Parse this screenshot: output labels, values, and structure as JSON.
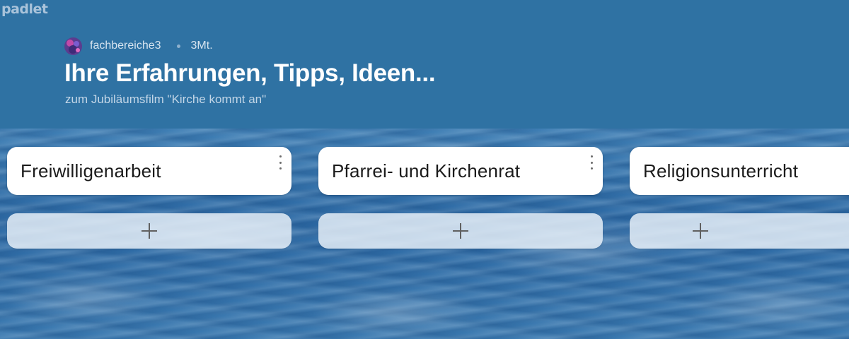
{
  "brand": {
    "logo_text": "padlet"
  },
  "header": {
    "author": "fachbereiche3",
    "time_ago": "3Mt.",
    "title": "Ihre Erfahrungen, Tipps, Ideen...",
    "subtitle": "zum Jubiläumsfilm \"Kirche kommt an\""
  },
  "columns": [
    {
      "title": "Freiwilligenarbeit",
      "menu_icon": "vertical-ellipsis-icon",
      "add_icon": "plus-icon"
    },
    {
      "title": "Pfarrei- und Kirchenrat",
      "menu_icon": "vertical-ellipsis-icon",
      "add_icon": "plus-icon"
    },
    {
      "title": "Religionsunterricht",
      "menu_icon": "vertical-ellipsis-icon",
      "add_icon": "plus-icon"
    }
  ],
  "colors": {
    "header_bg": "#2f72a3",
    "title_text": "#ffffff",
    "card_bg": "#ffffff",
    "add_post_bg": "#ecf3fa"
  }
}
